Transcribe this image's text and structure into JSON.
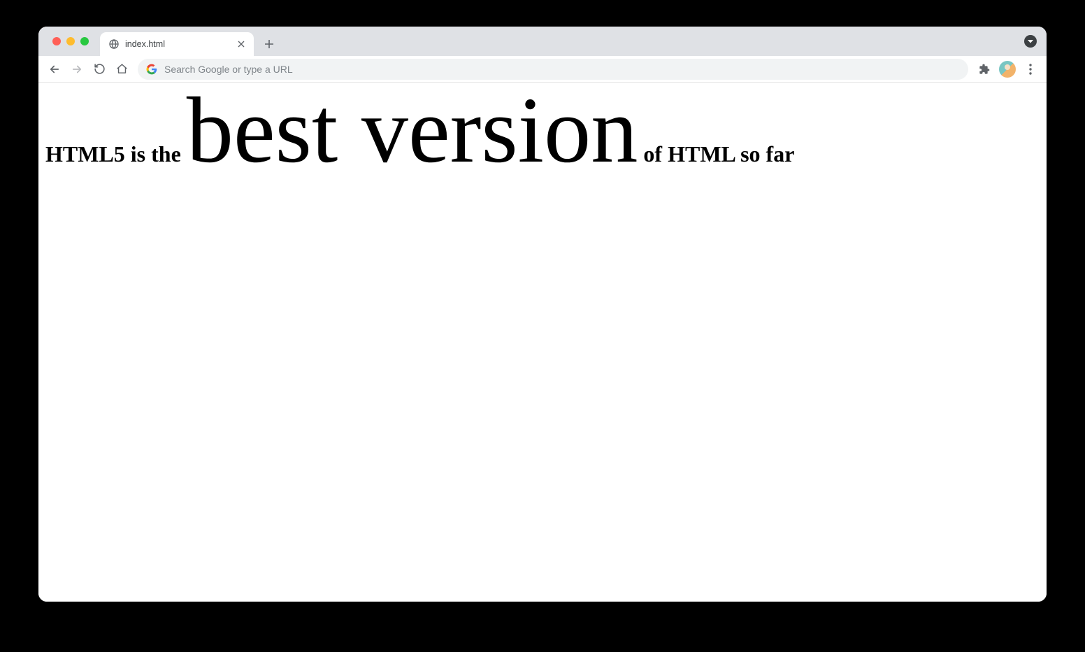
{
  "tab": {
    "title": "index.html"
  },
  "omnibox": {
    "placeholder": "Search Google or type a URL"
  },
  "page": {
    "h1_pre": "HTML5 is the ",
    "h1_big": "best version",
    "h1_post": " of HTML so far"
  }
}
